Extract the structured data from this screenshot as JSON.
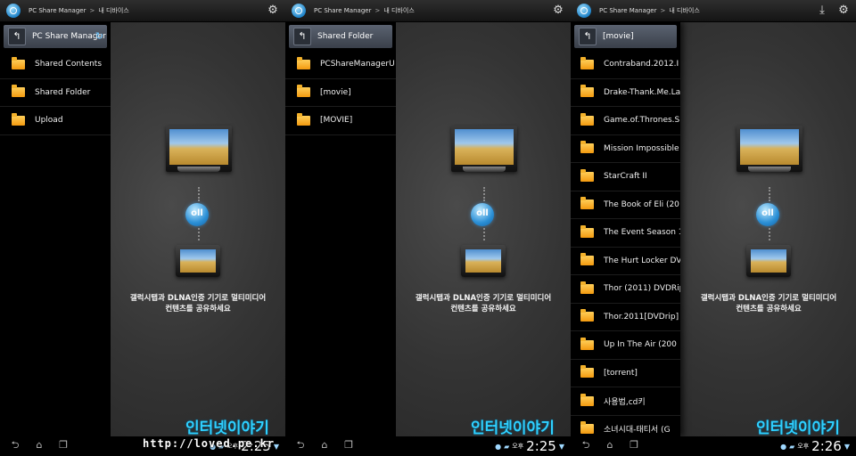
{
  "breadcrumb": {
    "app": "PC Share Manager",
    "separator": ">",
    "device": "내 디바이스"
  },
  "icons": {
    "app_logo": "dlna-icon",
    "settings": "gear-icon",
    "download": "download-icon",
    "up": "up-arrow-icon",
    "sync": "refresh-icon",
    "folder": "folder-icon"
  },
  "screens": [
    {
      "panel_title": "PC Share Manager",
      "folders": [
        "Shared Contents",
        "Shared Folder",
        "Upload"
      ],
      "clock": "2:25"
    },
    {
      "panel_title": "Shared Folder",
      "folders": [
        "PCShareManagerU",
        "[movie]",
        "[MOVIE]"
      ],
      "clock": "2:25"
    },
    {
      "panel_title": "[movie]",
      "folders": [
        "Contraband.2012.I",
        "Drake-Thank.Me.La",
        "Game.of.Thrones.S",
        "Mission Impossible",
        "StarCraft II",
        "The Book of Eli (20",
        "The Event Season 1",
        "The Hurt Locker DV",
        "Thor (2011) DVDRip",
        "Thor.2011[DVDrip]",
        "Up In The Air (200",
        "[torrent]",
        "사용법,cd키",
        "소녀시대-태티서 (G"
      ],
      "clock": "2:26"
    }
  ],
  "dlna_caption": {
    "line1": "갤럭시탭과 DLNA인증 기기로 멀티미디어",
    "line2": "컨텐츠를 공유하세요"
  },
  "status": {
    "ampm": "오후"
  },
  "watermark": {
    "text": "인터넷이야기",
    "url": "http://loved.pe.kr"
  },
  "colors": {
    "accent": "#2fd0ff",
    "folder": "#f3a712",
    "panel_bg": "#000000"
  }
}
